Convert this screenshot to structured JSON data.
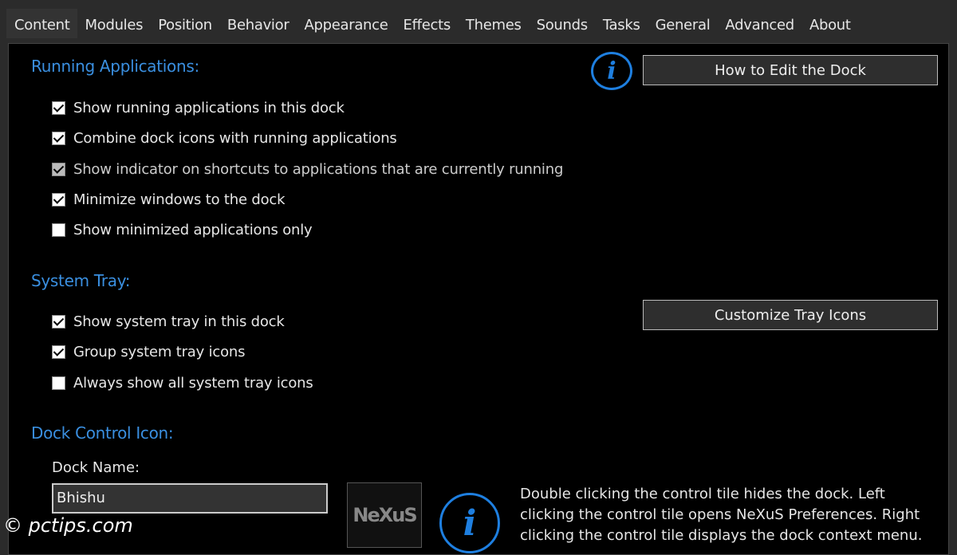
{
  "tabs": [
    "Content",
    "Modules",
    "Position",
    "Behavior",
    "Appearance",
    "Effects",
    "Themes",
    "Sounds",
    "Tasks",
    "General",
    "Advanced",
    "About"
  ],
  "active_tab": "Content",
  "running": {
    "heading": "Running Applications:",
    "button": "How to Edit the Dock",
    "options": [
      {
        "label": "Show running applications in this dock",
        "checked": true
      },
      {
        "label": "Combine dock icons with running applications",
        "checked": true
      },
      {
        "label": "Show indicator on shortcuts to applications that are currently running",
        "checked": true,
        "disabled": true
      },
      {
        "label": "Minimize windows to the dock",
        "checked": true
      },
      {
        "label": "Show minimized applications only",
        "checked": false
      }
    ]
  },
  "tray": {
    "heading": "System Tray:",
    "button": "Customize Tray Icons",
    "options": [
      {
        "label": "Show system tray in this dock",
        "checked": true
      },
      {
        "label": "Group system tray icons",
        "checked": true
      },
      {
        "label": "Always show all system tray icons",
        "checked": false
      }
    ]
  },
  "control": {
    "heading": "Dock Control Icon:",
    "name_label": "Dock Name:",
    "name_value": "Bhishu",
    "tile_logo": "NeXuS",
    "description": "Double clicking the control tile hides the dock. Left clicking the control tile opens NeXuS Preferences. Right clicking the control tile displays the dock context menu."
  },
  "info_icon": "i",
  "watermark": "© pctips.com",
  "colors": {
    "accent": "#3a8fe0",
    "info": "#1e7fe0"
  }
}
